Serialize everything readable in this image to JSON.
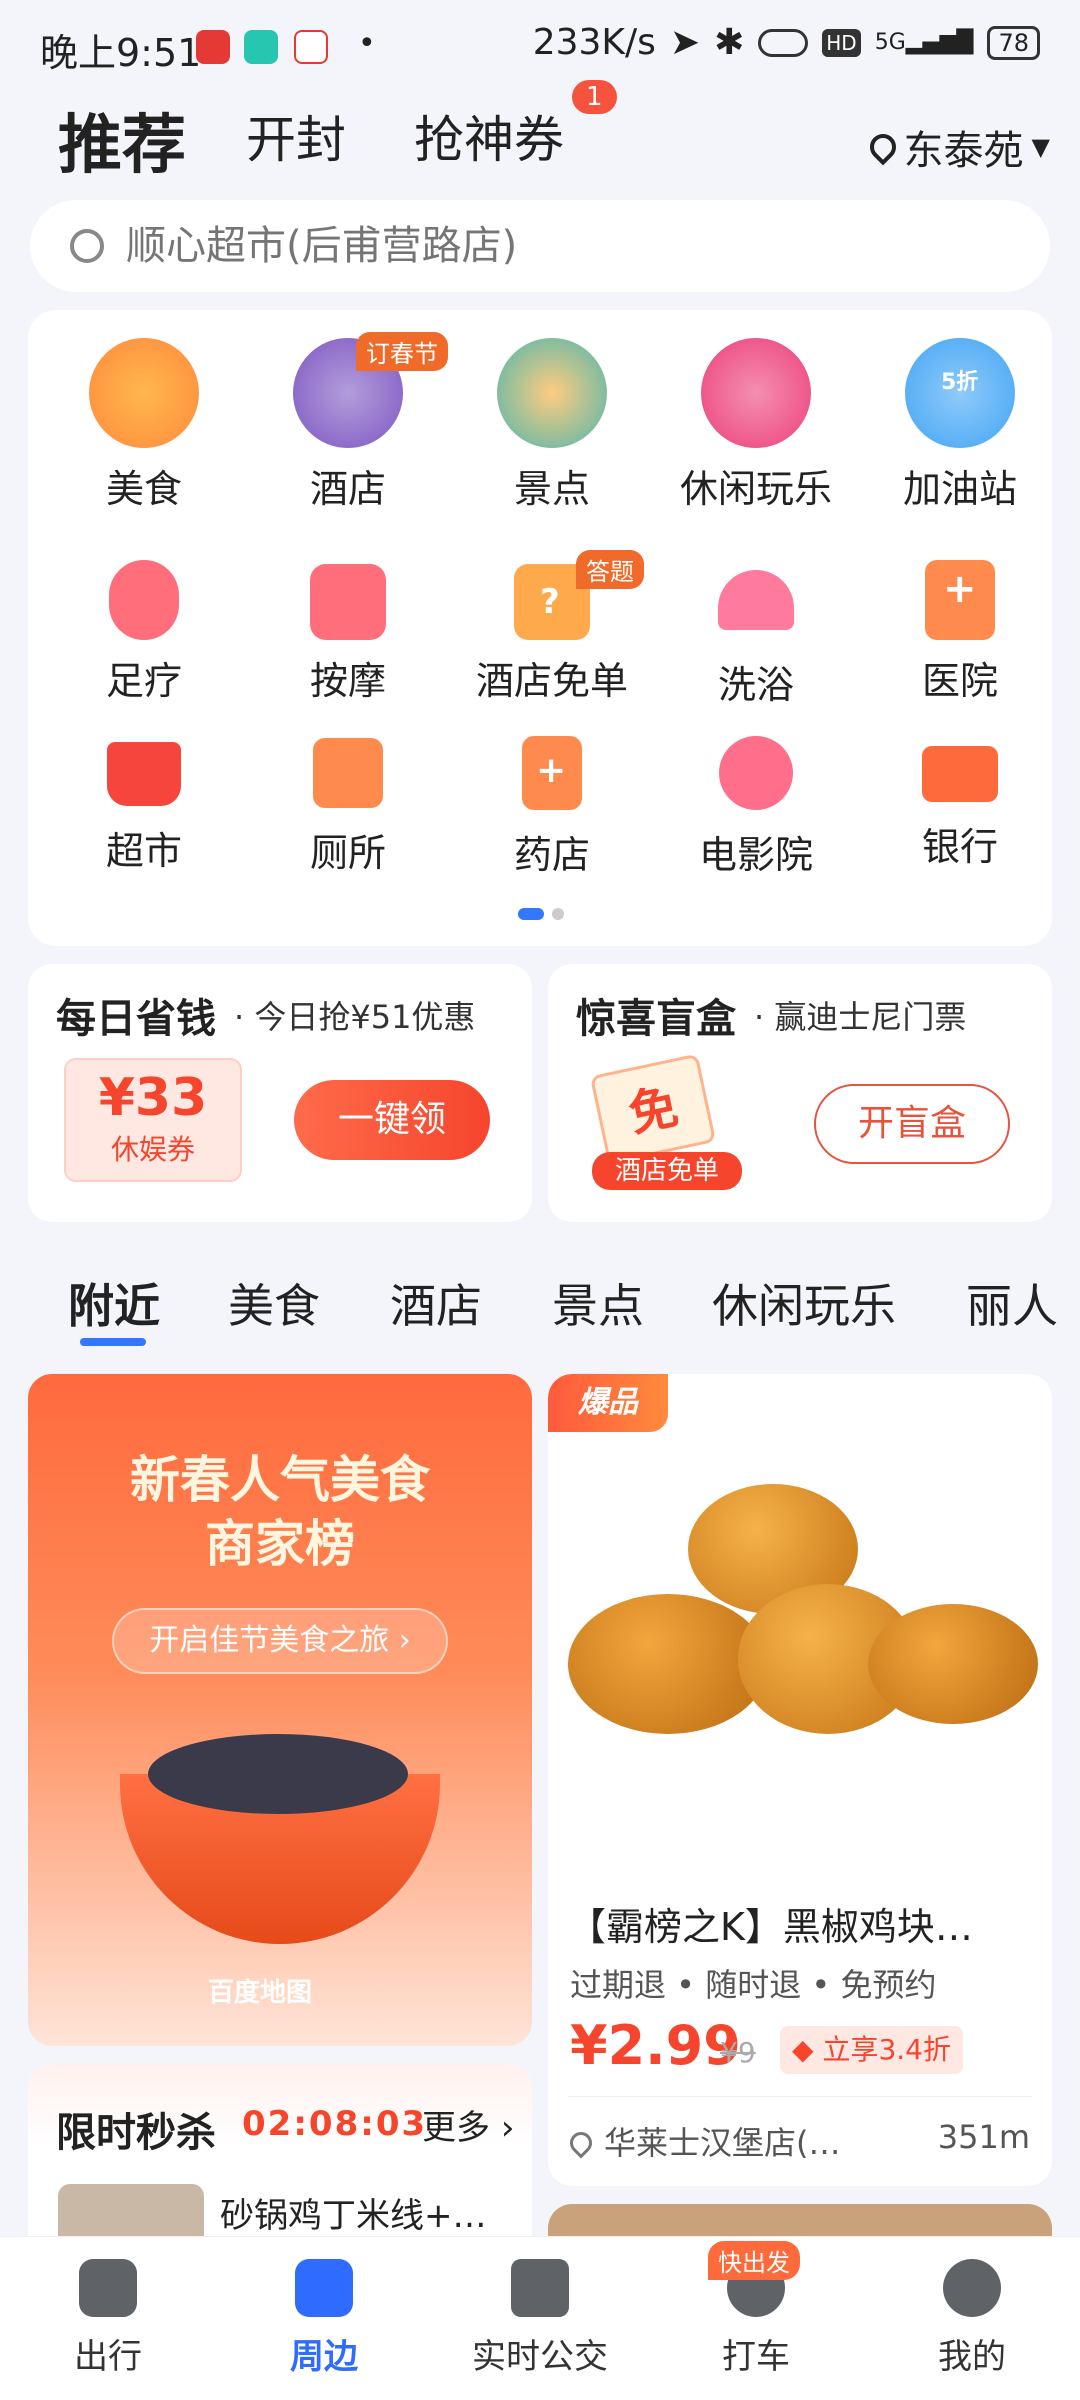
{
  "status_bar": {
    "time": "晚上9:51",
    "net_speed": "233K/s",
    "hd": "HD",
    "signal": "5G",
    "battery": "78"
  },
  "header": {
    "tabs": [
      {
        "label": "推荐"
      },
      {
        "label": "开封"
      },
      {
        "label": "抢神券",
        "badge": "1"
      }
    ],
    "location": "东泰苑"
  },
  "search": {
    "placeholder": "顺心超市(后甫营路店)"
  },
  "grid": {
    "items": [
      {
        "label": "美食",
        "icon": "roast-chicken-icon"
      },
      {
        "label": "酒店",
        "icon": "hotel-receptionist-icon",
        "tag": "订春节"
      },
      {
        "label": "景点",
        "icon": "pavilion-icon"
      },
      {
        "label": "休闲玩乐",
        "icon": "gamepad-icon"
      },
      {
        "label": "加油站",
        "icon": "fuel-pump-icon",
        "sub": "5折"
      },
      {
        "label": "足疗",
        "icon": "foot-icon"
      },
      {
        "label": "按摩",
        "icon": "massage-icon"
      },
      {
        "label": "酒店免单",
        "icon": "question-box-icon",
        "tag": "答题"
      },
      {
        "label": "洗浴",
        "icon": "shower-icon"
      },
      {
        "label": "医院",
        "icon": "hospital-icon"
      },
      {
        "label": "超市",
        "icon": "cart-icon"
      },
      {
        "label": "厕所",
        "icon": "toilet-icon"
      },
      {
        "label": "药店",
        "icon": "pharmacy-icon"
      },
      {
        "label": "电影院",
        "icon": "film-reel-icon"
      },
      {
        "label": "银行",
        "icon": "bank-card-icon"
      }
    ]
  },
  "promo": {
    "daily": {
      "title": "每日省钱",
      "sub": "· 今日抢¥51优惠",
      "coupon_amount": "¥33",
      "coupon_type": "休娱券",
      "button": "一键领"
    },
    "box": {
      "title": "惊喜盲盒",
      "sub": "· 赢迪士尼门票",
      "badge_char": "免",
      "ribbon": "酒店免单",
      "button": "开盲盒"
    }
  },
  "category_tabs": [
    "附近",
    "美食",
    "酒店",
    "景点",
    "休闲玩乐",
    "丽人"
  ],
  "banner": {
    "title_line1": "新春人气美食",
    "title_line2": "商家榜",
    "cta": "开启佳节美食之旅 ›",
    "brand": "百度地图"
  },
  "product": {
    "hot_tag": "爆品",
    "title": "【霸榜之K】黑椒鸡块…",
    "features": "过期退 • 随时退 • 免预约",
    "price": "¥2.99",
    "original_price": "¥9",
    "discount": "立享3.4折",
    "store": "华莱士汉堡店(…",
    "distance": "351m"
  },
  "seckill": {
    "title": "限时秒杀",
    "countdown": "02:08:03",
    "more": "更多",
    "item_title": "砂锅鸡丁米线+…"
  },
  "nav": {
    "items": [
      {
        "label": "出行"
      },
      {
        "label": "周边"
      },
      {
        "label": "实时公交"
      },
      {
        "label": "打车",
        "tag": "快出发"
      },
      {
        "label": "我的"
      }
    ]
  },
  "colors": {
    "accent": "#2f6bff",
    "red": "#f5452d",
    "orange": "#f06a2a",
    "bg": "#f3f5fa"
  }
}
